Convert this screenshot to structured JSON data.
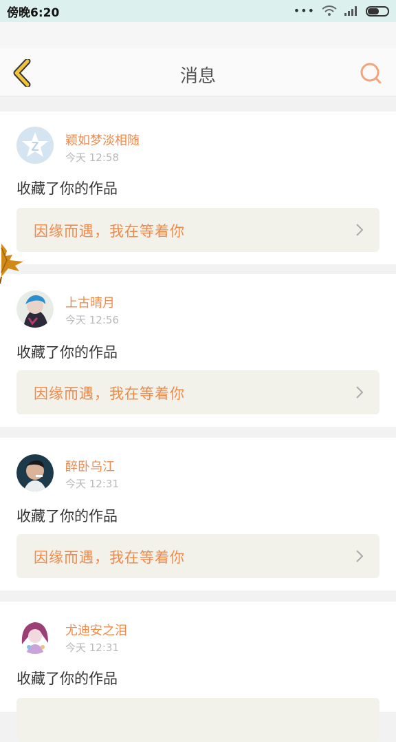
{
  "status_bar": {
    "time": "傍晚6:20",
    "dots": "•••",
    "icons": [
      "wifi-icon",
      "signal-icon",
      "battery-icon"
    ]
  },
  "header": {
    "title": "消息",
    "back_icon": "back-chevron-icon",
    "search_icon": "search-icon"
  },
  "messages": [
    {
      "username": "颖如梦淡相随",
      "time": "今天 12:58",
      "action": "收藏了你的作品",
      "work_title": "因缘而遇，我在等着你",
      "avatar": "qq-default-avatar"
    },
    {
      "username": "上古晴月",
      "time": "今天 12:56",
      "action": "收藏了你的作品",
      "work_title": "因缘而遇，我在等着你",
      "avatar": "user-photo-avatar"
    },
    {
      "username": "醉卧乌江",
      "time": "今天 12:31",
      "action": "收藏了你的作品",
      "work_title": "因缘而遇，我在等着你",
      "avatar": "user-photo-avatar"
    },
    {
      "username": "尤迪安之泪",
      "time": "今天 12:31",
      "action": "收藏了你的作品",
      "work_title": "",
      "avatar": "user-photo-avatar"
    }
  ],
  "colors": {
    "accent": "#f08a4b",
    "back_icon": "#f0c33c",
    "status_bar_bg": "#dcf1ee",
    "work_box_bg": "#f3f2ea"
  }
}
